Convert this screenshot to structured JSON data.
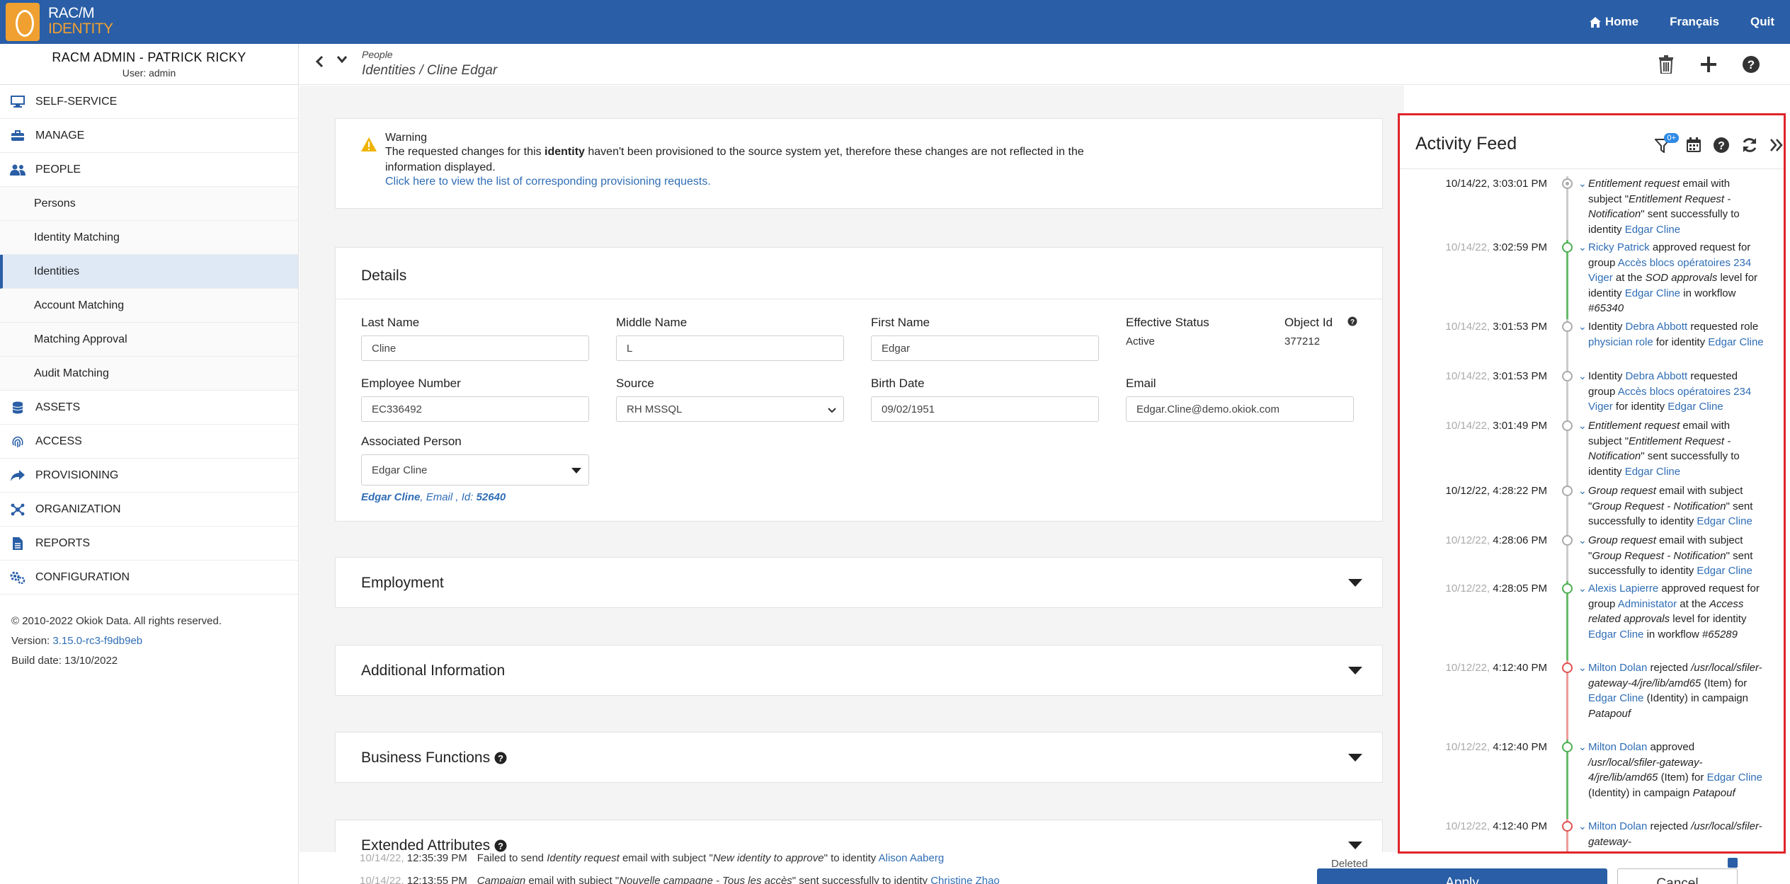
{
  "app": {
    "logo_line1": "RAC/M",
    "logo_line2": "IDENTITY"
  },
  "topnav": {
    "home": "Home",
    "lang": "Français",
    "quit": "Quit"
  },
  "user": {
    "name": "RACM ADMIN - PATRICK RICKY",
    "sub": "User: admin"
  },
  "sidebar": {
    "items": [
      {
        "label": "SELF-SERVICE",
        "icon": "monitor-icon"
      },
      {
        "label": "MANAGE",
        "icon": "toolbox-icon"
      },
      {
        "label": "PEOPLE",
        "icon": "users-icon"
      }
    ],
    "people_sub": [
      "Persons",
      "Identity Matching",
      "Identities",
      "Account Matching",
      "Matching Approval",
      "Audit Matching"
    ],
    "items2": [
      {
        "label": "ASSETS",
        "icon": "database-icon"
      },
      {
        "label": "ACCESS",
        "icon": "fingerprint-icon"
      },
      {
        "label": "PROVISIONING",
        "icon": "share-icon"
      },
      {
        "label": "ORGANIZATION",
        "icon": "network-icon"
      },
      {
        "label": "REPORTS",
        "icon": "report-icon"
      },
      {
        "label": "CONFIGURATION",
        "icon": "gears-icon"
      }
    ],
    "copyright": "© 2010-2022 Okiok Data. All rights reserved.",
    "version_label": "Version:",
    "version": "3.15.0-rc3-f9db9eb",
    "build": "Build date: 13/10/2022"
  },
  "header": {
    "crumb_top": "People",
    "crumb_main": "Identities / Cline Edgar"
  },
  "warning": {
    "title": "Warning",
    "text_a": "The requested changes for this",
    "text_b": "identity",
    "text_c": "haven't been provisioned to the source system yet, therefore these changes are not reflected in the information displayed.",
    "link": "Click here to view the list of corresponding provisioning requests."
  },
  "details": {
    "title": "Details",
    "last_name_label": "Last Name",
    "last_name": "Cline",
    "middle_name_label": "Middle Name",
    "middle_name": "L",
    "first_name_label": "First Name",
    "first_name": "Edgar",
    "eff_status_label": "Effective Status",
    "eff_status": "Active",
    "object_id_label": "Object Id",
    "object_id": "377212",
    "emp_num_label": "Employee Number",
    "emp_num": "EC336492",
    "source_label": "Source",
    "source": "RH MSSQL",
    "birth_label": "Birth Date",
    "birth": "09/02/1951",
    "email_label": "Email",
    "email": "Edgar.Cline@demo.okiok.com",
    "assoc_label": "Associated Person",
    "assoc": "Edgar Cline",
    "assoc_name": "Edgar Cline",
    "assoc_email": ", Email , Id:",
    "assoc_id": "52640"
  },
  "sections": {
    "employment": "Employment",
    "additional": "Additional Information",
    "business": "Business Functions",
    "extended": "Extended Attributes"
  },
  "bottom": {
    "row1_date": "10/14/22,",
    "row1_time": "12:35:39 PM",
    "row1_a": "Failed to send",
    "row1_b": "Identity request",
    "row1_c": "email with subject \"",
    "row1_d": "New identity to approve",
    "row1_e": "\" to identity",
    "row1_link": "Alison Aaberg",
    "row2_date": "10/14/22,",
    "row2_time": "12:13:55 PM",
    "row2_a": "Campaign",
    "row2_b": "email with subject \"",
    "row2_c": "Nouvelle campagne - Tous les accès",
    "row2_d": "\" sent successfully to identity",
    "row2_link": "Christine Zhao",
    "deleted": "Deleted",
    "apply": "Apply",
    "cancel": "Cancel"
  },
  "feed": {
    "title": "Activity Feed",
    "filter_badge": "0+",
    "entries": [
      {
        "date": "10/14/22,",
        "time": "3:03:01 PM",
        "date_strong": true
      },
      {
        "date": "10/14/22,",
        "time": "3:02:59 PM"
      },
      {
        "date": "10/14/22,",
        "time": "3:01:53 PM"
      },
      {
        "date": "10/14/22,",
        "time": "3:01:53 PM"
      },
      {
        "date": "10/14/22,",
        "time": "3:01:49 PM"
      },
      {
        "date": "10/12/22,",
        "time": "4:28:22 PM",
        "date_strong": true
      },
      {
        "date": "10/12/22,",
        "time": "4:28:06 PM"
      },
      {
        "date": "10/12/22,",
        "time": "4:28:05 PM"
      },
      {
        "date": "10/12/22,",
        "time": "4:12:40 PM"
      },
      {
        "date": "10/12/22,",
        "time": "4:12:40 PM"
      },
      {
        "date": "10/12/22,",
        "time": "4:12:40 PM"
      }
    ],
    "t": {
      "entitlement_request": "Entitlement request",
      "email_with_subject": "email with subject \"",
      "ent_notif": "Entitlement Request - Notification",
      "sent_to_identity": "\" sent successfully to identity",
      "edgar_cline": "Edgar Cline",
      "edgar": "Edgar",
      "cline": "Cline",
      "ricky_patrick": "Ricky Patrick",
      "approved_request_for_group": "approved request for group",
      "group_acces": "Accès blocs opératoires 234 Viger",
      "at_the": "at the",
      "sod_approvals": "SOD approvals",
      "level_for_identity": "level for identity",
      "in_workflow": "in workflow",
      "wf1": "#65340",
      "identity": "Identity",
      "debra_abbott": "Debra Abbott",
      "requested_role": "requested role",
      "physician_role": "physician role",
      "for_identity": "for identity",
      "requested_group": "requested group",
      "group_request": "Group request",
      "grp_notif": "Group Request - Notification",
      "alexis_lapierre": "Alexis Lapierre",
      "administator": "Administator",
      "access_related": "Access related approvals",
      "wf2": "#65289",
      "milton_dolan": "Milton Dolan",
      "rejected": "rejected",
      "approved": "approved",
      "path": "/usr/local/sfiler-gateway-4/jre/lib/amd65",
      "path_short": "/usr/local/sfiler-gateway-",
      "item_for": "(Item) for",
      "identity_in_campaign": "(Identity) in campaign",
      "patapouf": "Patapouf"
    }
  },
  "colors": {
    "brand": "#2a5ea6",
    "accent": "#f0a030",
    "link": "#2f6db5",
    "feed_border": "#e0242a",
    "green": "#4caf50",
    "red": "#e05050",
    "grey": "#aaaaaa"
  }
}
